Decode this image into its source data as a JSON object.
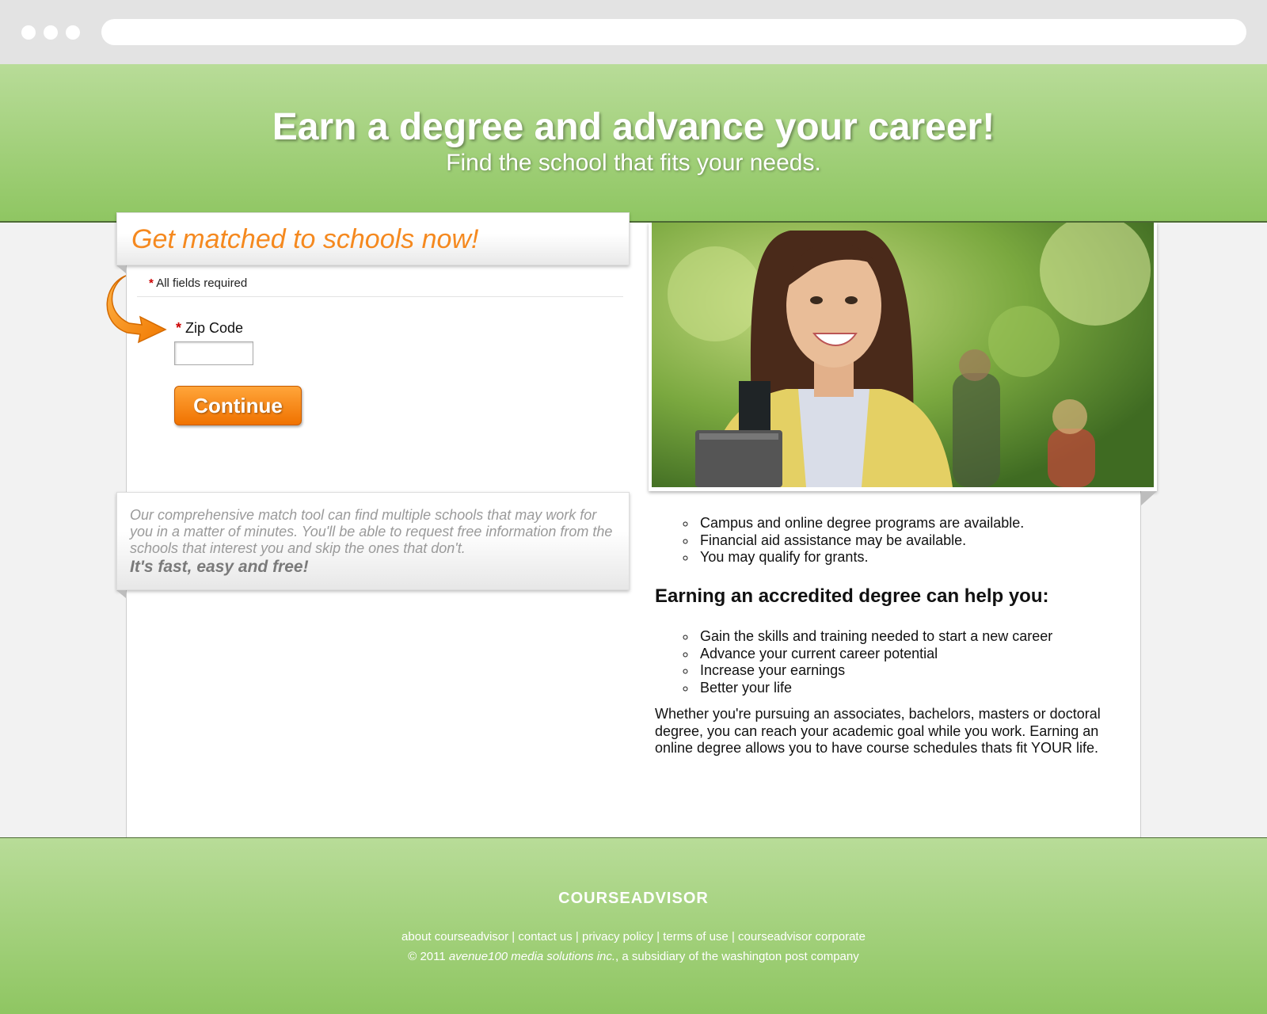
{
  "hero": {
    "title": "Earn a degree and advance your career!",
    "subtitle": "Find the school that fits your needs."
  },
  "form": {
    "heading": "Get matched to schools now!",
    "required_star": "*",
    "required_note": "All fields required",
    "zip_label": "Zip Code",
    "zip_value": "",
    "continue_label": "Continue"
  },
  "info": {
    "text": "Our comprehensive match tool can find multiple schools that may work for you in a matter of minutes. You'll be able to request free information from the schools that interest you and skip the ones that don't.",
    "tagline": "It's fast, easy and free!"
  },
  "benefits": [
    "Campus and online degree programs are available.",
    "Financial aid assistance may be available.",
    "You may qualify for grants."
  ],
  "help": {
    "heading": "Earning an accredited degree can help you:",
    "items": [
      "Gain the skills and training needed to start a new career",
      "Advance your current career potential",
      "Increase your earnings",
      "Better your life"
    ],
    "paragraph": "Whether you're pursuing an associates, bachelors, masters or doctoral degree, you can reach your academic goal while you work. Earning an online degree allows you to have course schedules thats fit YOUR life."
  },
  "footer": {
    "logo": "COURSEADVISOR",
    "links": [
      "about courseadvisor",
      "contact us",
      "privacy policy",
      "terms of use",
      "courseadvisor corporate"
    ],
    "separator": " | ",
    "copyright_prefix": "© 2011 ",
    "copyright_company": "avenue100 media solutions inc.",
    "copyright_suffix": ", a subsidiary of the washington post company"
  },
  "colors": {
    "green_light": "#b8dc98",
    "green_dark": "#8fc662",
    "orange": "#f5891f",
    "button": "#f07200"
  }
}
